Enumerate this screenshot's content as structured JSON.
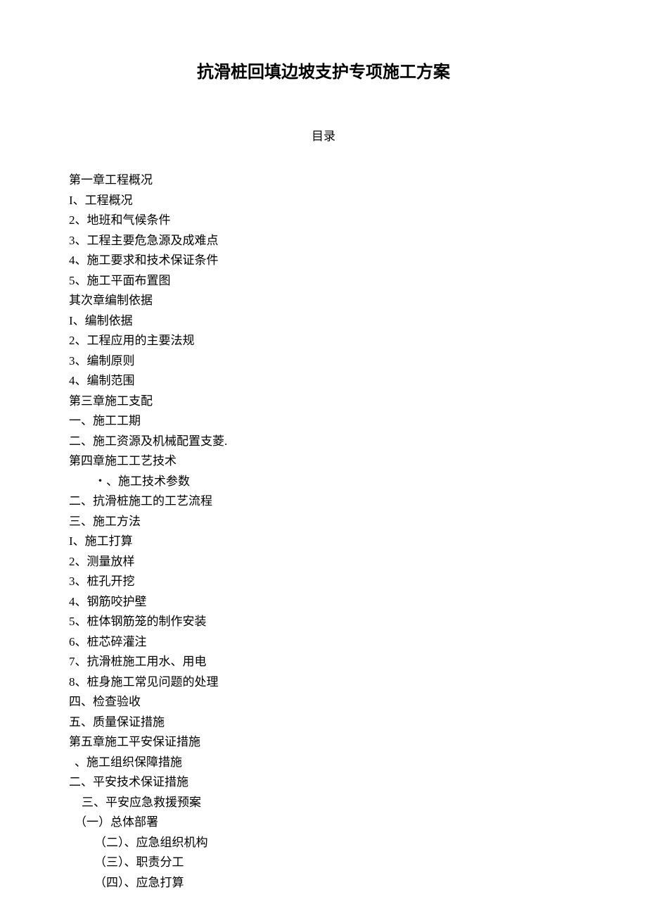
{
  "title": "抗滑桩回填边坡支护专项施工方案",
  "subtitle": "目录",
  "toc": [
    {
      "text": "第一章工程概况",
      "indent": ""
    },
    {
      "text": "I、工程概况",
      "indent": ""
    },
    {
      "text": "2、地班和气候条件",
      "indent": ""
    },
    {
      "text": "3、工程主要危急源及成难点",
      "indent": ""
    },
    {
      "text": "4、施工要求和技术保证条件",
      "indent": ""
    },
    {
      "text": "5、施工平面布置图",
      "indent": ""
    },
    {
      "text": "其次章编制依据",
      "indent": ""
    },
    {
      "text": "I、编制依据",
      "indent": ""
    },
    {
      "text": "2、工程应用的主要法规",
      "indent": ""
    },
    {
      "text": "3、编制原则",
      "indent": ""
    },
    {
      "text": "4、编制范围",
      "indent": ""
    },
    {
      "text": "第三章施工支配",
      "indent": ""
    },
    {
      "text": "一、施工工期",
      "indent": ""
    },
    {
      "text": "二、施工资源及机械配置支菱.",
      "indent": ""
    },
    {
      "text": "第四章施工工艺技术",
      "indent": ""
    },
    {
      "text": "・、施工技术参数",
      "indent": "indent-2"
    },
    {
      "text": "二、抗滑桩施工的工艺流程",
      "indent": ""
    },
    {
      "text": "三、施工方法",
      "indent": ""
    },
    {
      "text": "I、施工打算",
      "indent": ""
    },
    {
      "text": "2、测量放样",
      "indent": ""
    },
    {
      "text": "3、桩孔开挖",
      "indent": ""
    },
    {
      "text": "4、钢筋咬护壁",
      "indent": ""
    },
    {
      "text": "5、桩体钢筋笼的制作安装",
      "indent": ""
    },
    {
      "text": "6、桩芯碎灌注",
      "indent": ""
    },
    {
      "text": "7、抗滑桩施工用水、用电",
      "indent": ""
    },
    {
      "text": "8、桩身施工常见问题的处理",
      "indent": ""
    },
    {
      "text": "四、检查验收",
      "indent": ""
    },
    {
      "text": "五、质量保证措施",
      "indent": ""
    },
    {
      "text": "第五章施工平安保证措施",
      "indent": ""
    },
    {
      "text": "、施工组织保障措施",
      "indent": "indent-small"
    },
    {
      "text": "二、平安技术保证措施",
      "indent": ""
    },
    {
      "text": "三、平安应急救援预案",
      "indent": "indent-1"
    },
    {
      "text": "（一）总体部署",
      "indent": "indent-small"
    },
    {
      "text": "（二）、应急组织机构",
      "indent": "indent-2"
    },
    {
      "text": "（三）、职责分工",
      "indent": "indent-2"
    },
    {
      "text": "（四）、应急打算",
      "indent": "indent-2"
    }
  ]
}
